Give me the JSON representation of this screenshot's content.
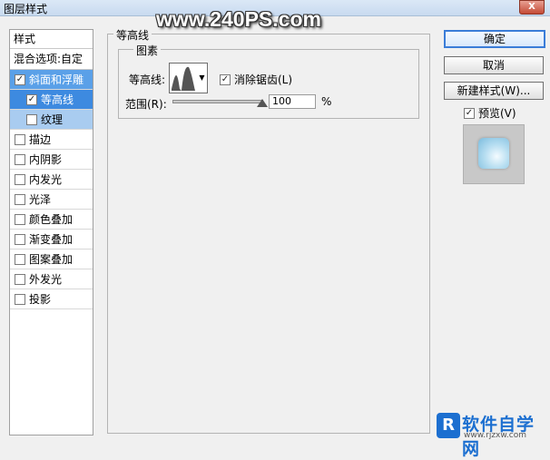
{
  "window": {
    "title": "图层样式",
    "close_label": "X"
  },
  "watermark": "www.240PS.com",
  "left_panel": {
    "header": "样式",
    "blend_options": "混合选项:自定",
    "items": [
      {
        "label": "斜面和浮雕",
        "checked": true
      },
      {
        "label": "等高线",
        "checked": true
      },
      {
        "label": "纹理",
        "checked": false
      },
      {
        "label": "描边",
        "checked": false
      },
      {
        "label": "内阴影",
        "checked": false
      },
      {
        "label": "内发光",
        "checked": false
      },
      {
        "label": "光泽",
        "checked": false
      },
      {
        "label": "颜色叠加",
        "checked": false
      },
      {
        "label": "渐变叠加",
        "checked": false
      },
      {
        "label": "图案叠加",
        "checked": false
      },
      {
        "label": "外发光",
        "checked": false
      },
      {
        "label": "投影",
        "checked": false
      }
    ]
  },
  "main": {
    "group_title": "等高线",
    "subgroup_title": "图素",
    "contour_label": "等高线:",
    "anti_alias_label": "消除锯齿(L)",
    "anti_alias_checked": true,
    "range_label": "范围(R):",
    "range_value": "100",
    "range_unit": "%"
  },
  "buttons": {
    "ok": "确定",
    "cancel": "取消",
    "new_style": "新建样式(W)...",
    "preview": "预览(V)",
    "preview_checked": true
  },
  "logo": {
    "mark": "R",
    "name": "软件自学网",
    "url": "www.rjzxw.com"
  },
  "colors": {
    "active_item": "#5aa0e8",
    "active_subitem": "#3d8ae0",
    "primary_border": "#3b7dd8"
  }
}
